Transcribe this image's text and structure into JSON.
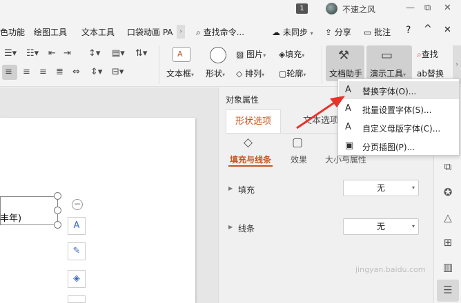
{
  "titlebar": {
    "badge": "1",
    "username": "不速之风",
    "min": "—",
    "restore": "⧉",
    "close": "✕"
  },
  "tabs": {
    "items": [
      "色功能",
      "绘图工具",
      "文本工具",
      "口袋动画 PA"
    ],
    "more_arrow": "›",
    "search": "查找命令...",
    "sync": "未同步",
    "share": "分享",
    "comment": "批注",
    "help": "?",
    "collapse": "^",
    "close": "✕"
  },
  "ribbon": {
    "textbox": "文本框",
    "shape": "形状",
    "picture": "图片",
    "fill": "填充",
    "arrange": "排列",
    "outline": "轮廓",
    "doc_helper": "文档助手",
    "present_tools": "演示工具",
    "find": "查找",
    "replace": "替换"
  },
  "canvas": {
    "shape_text": "丰年)"
  },
  "panel": {
    "title": "对象属性",
    "tab_shape": "形状选项",
    "tab_text": "文本选项",
    "sub_fill_line": "填充与线条",
    "sub_effect": "效果",
    "sub_size": "大小与属性",
    "fill_label": "填充",
    "fill_value": "无",
    "line_label": "线条",
    "line_value": "无"
  },
  "menu": {
    "items": [
      {
        "icon": "A",
        "label": "替换字体(O)..."
      },
      {
        "icon": "A",
        "label": "批量设置字体(S)..."
      },
      {
        "icon": "A",
        "label": "自定义母版字体(C)..."
      },
      {
        "icon": "▣",
        "label": "分页插图(P)..."
      }
    ]
  },
  "watermark": "jingyan.baidu.com",
  "colors": {
    "accent": "#c8541f",
    "arrow": "#e8332a"
  }
}
